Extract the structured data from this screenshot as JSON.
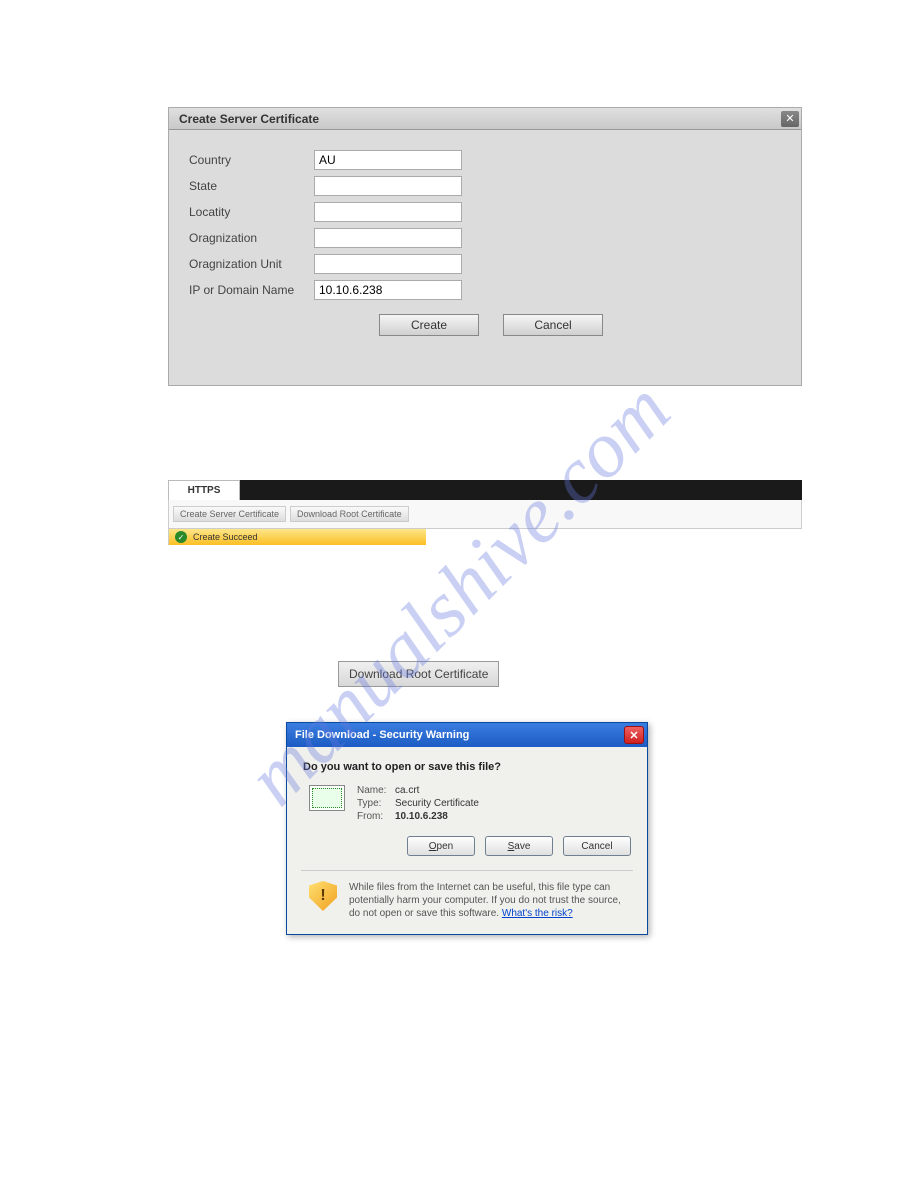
{
  "watermark": "manualshive.com",
  "panel1": {
    "title": "Create Server Certificate",
    "fields": {
      "country_label": "Country",
      "country_value": "AU",
      "state_label": "State",
      "state_value": "",
      "locality_label": "Locatity",
      "locality_value": "",
      "org_label": "Oragnization",
      "org_value": "",
      "orgunit_label": "Oragnization Unit",
      "orgunit_value": "",
      "ip_label": "IP or Domain Name",
      "ip_value": "10.10.6.238"
    },
    "create_label": "Create",
    "cancel_label": "Cancel"
  },
  "panel2": {
    "tab_label": "HTTPS",
    "btn_create": "Create Server Certificate",
    "btn_download": "Download Root Certificate",
    "status_text": "Create Succeed"
  },
  "panel3": {
    "download_label": "Download Root Certificate"
  },
  "panel4": {
    "title": "File Download - Security Warning",
    "question": "Do you want to open or save this file?",
    "name_label": "Name:",
    "name_value": "ca.crt",
    "type_label": "Type:",
    "type_value": "Security Certificate",
    "from_label": "From:",
    "from_value": "10.10.6.238",
    "open_underline": "O",
    "open_rest": "pen",
    "save_underline": "S",
    "save_rest": "ave",
    "cancel": "Cancel",
    "warning": "While files from the Internet can be useful, this file type can potentially harm your computer. If you do not trust the source, do not open or save this software. ",
    "risk_link": "What's the risk?"
  }
}
